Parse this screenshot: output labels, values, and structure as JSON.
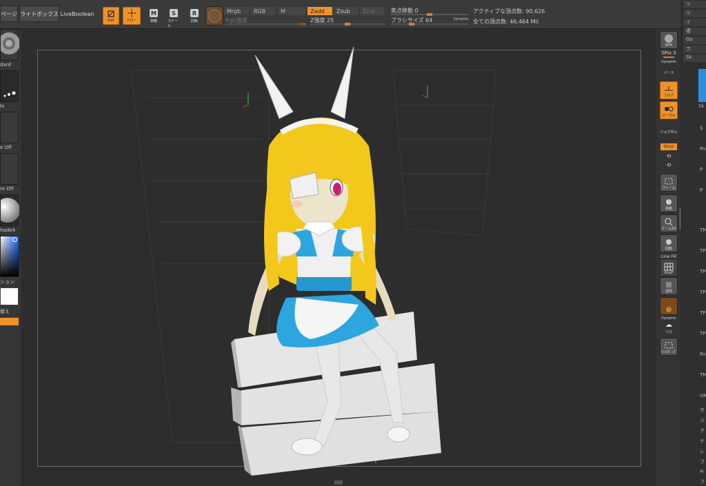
{
  "toolbar": {
    "page_tab": "ページ",
    "lightbox": "ライトボックス",
    "liveboolean": "LiveBoolean",
    "edit": "Edit",
    "draw": "ドロー",
    "move": "移動",
    "scale": "スケール",
    "rotate": "回転",
    "icon_m": "M",
    "icon_s": "S",
    "icon_r": "R",
    "mrgb": "Mrgb",
    "rgb": "RGB",
    "m": "M",
    "rgb_intensity": "Rgb強度",
    "zadd": "Zadd",
    "zsub": "Zsub",
    "zcut": "Zcut",
    "z_intensity": "Z強度 25",
    "focal_shift": "焦点移動 0",
    "brush_size": "ブラシサイズ 64",
    "dynamic": "Dynamic",
    "active_points": "アクティブな頂点数: 90,626",
    "total_points": "全ての頂点数: 46.464 Mil"
  },
  "left_panel": {
    "brush_label": "dard",
    "stroke_label": "ts",
    "alpha_label": "e Off",
    "texture_label": "re Off",
    "material_label": "hade4",
    "gradient_label": "ション",
    "swap_label": "替え"
  },
  "right_shelf": {
    "bpr": "BPR",
    "spix": "SPix 3",
    "dynamic": "Dynamic",
    "perspective": "パース",
    "floor": "フロア",
    "local": "ローカル",
    "gizmo": "ジョグ中心",
    "xyz": "Qxyz",
    "frame": "フレーム",
    "move": "移動",
    "zoom3d": "ズーム3D",
    "rotate": "回転",
    "linefill": "Line Fill",
    "polyf": "PolyF",
    "transp": "透明",
    "dynamic2": "Dynamic",
    "solo": "ソロ",
    "xpose": "ﾄﾗﾝｽﾎﾟｰｽﾞ"
  },
  "far_right": {
    "items": [
      "ツ",
      "ツ",
      "イ",
      "複",
      "Go",
      "ラ",
      "Sk"
    ],
    "labels": [
      "Sk",
      "S",
      "Po",
      "P",
      "P",
      "TM",
      "TP",
      "TP",
      "TP",
      "TP",
      "TP",
      "Po",
      "TM",
      "UM",
      "サ",
      "ジ",
      "ア",
      "ナ",
      "レ",
      "フ",
      "H",
      "フ"
    ]
  },
  "colors": {
    "accent": "#f0922a",
    "panel": "#3a3a3a",
    "viewport": "#2d2d2d"
  }
}
